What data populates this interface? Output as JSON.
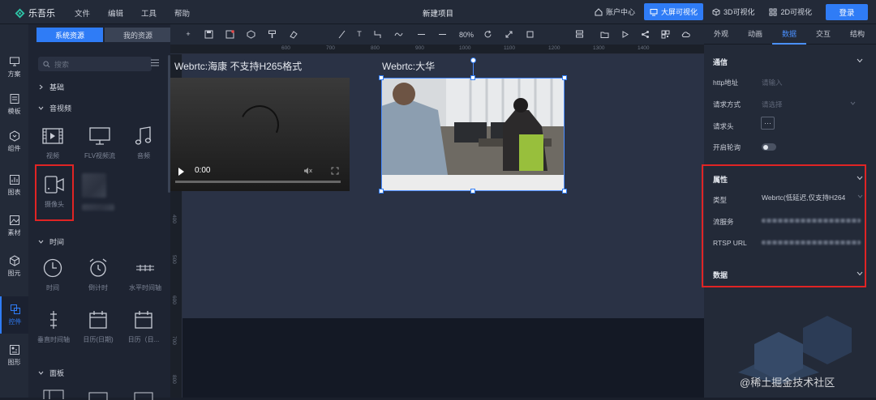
{
  "app": {
    "name": "乐吾乐",
    "menus": [
      "文件",
      "编辑",
      "工具",
      "帮助"
    ],
    "project_title": "新建项目",
    "nav": {
      "account": "账户中心",
      "big_screen": "大屏可视化",
      "viz3d": "3D可视化",
      "viz2d": "2D可视化",
      "login": "登录"
    }
  },
  "left_rail": {
    "items": [
      "方案",
      "模板",
      "组件",
      "图表",
      "素材",
      "图元",
      "控件",
      "图形"
    ],
    "active_index": 6
  },
  "library": {
    "tabs": [
      "系统资源",
      "我的资源"
    ],
    "active_tab": 0,
    "search_placeholder": "搜索",
    "categories": {
      "basic": "基础",
      "av": "音视频",
      "time": "时间",
      "panel": "面板"
    },
    "av_widgets": [
      "视频",
      "FLV视频流",
      "音频",
      "摄像头"
    ],
    "time_widgets": [
      "时间",
      "倒计时",
      "水平时间轴",
      "垂直时间轴",
      "日历(日期)",
      "日历（日..."
    ]
  },
  "toolbar": {
    "zoom": "80%",
    "text_tool": "T"
  },
  "ruler": {
    "top": [
      "600",
      "700",
      "800",
      "900",
      "1000",
      "1100",
      "1200",
      "1300",
      "1400"
    ],
    "left": [
      "100",
      "200",
      "300",
      "400",
      "500",
      "600",
      "700",
      "800"
    ]
  },
  "canvas": {
    "video1_title": "Webrtc:海康 不支持H265格式",
    "video1_time": "0:00",
    "video2_title": "Webrtc:大华"
  },
  "props": {
    "tabs": [
      "外观",
      "动画",
      "数据",
      "交互",
      "结构"
    ],
    "active_tab": 2,
    "comm": {
      "title": "通信",
      "http_label": "http地址",
      "http_placeholder": "请输入",
      "method_label": "请求方式",
      "method_placeholder": "请选择",
      "headers_label": "请求头",
      "headers_btn": "···",
      "polling_label": "开启轮询",
      "polling_on": false
    },
    "attr": {
      "title": "属性",
      "type_label": "类型",
      "type_value": "Webrtc(低延迟,仅支持H264",
      "stream_label": "流服务",
      "rtsp_label": "RTSP URL"
    },
    "data_section": "数据"
  },
  "watermark": "@稀土掘金技术社区",
  "colors": {
    "accent": "#2f7cf6",
    "highlight": "#e02424"
  }
}
